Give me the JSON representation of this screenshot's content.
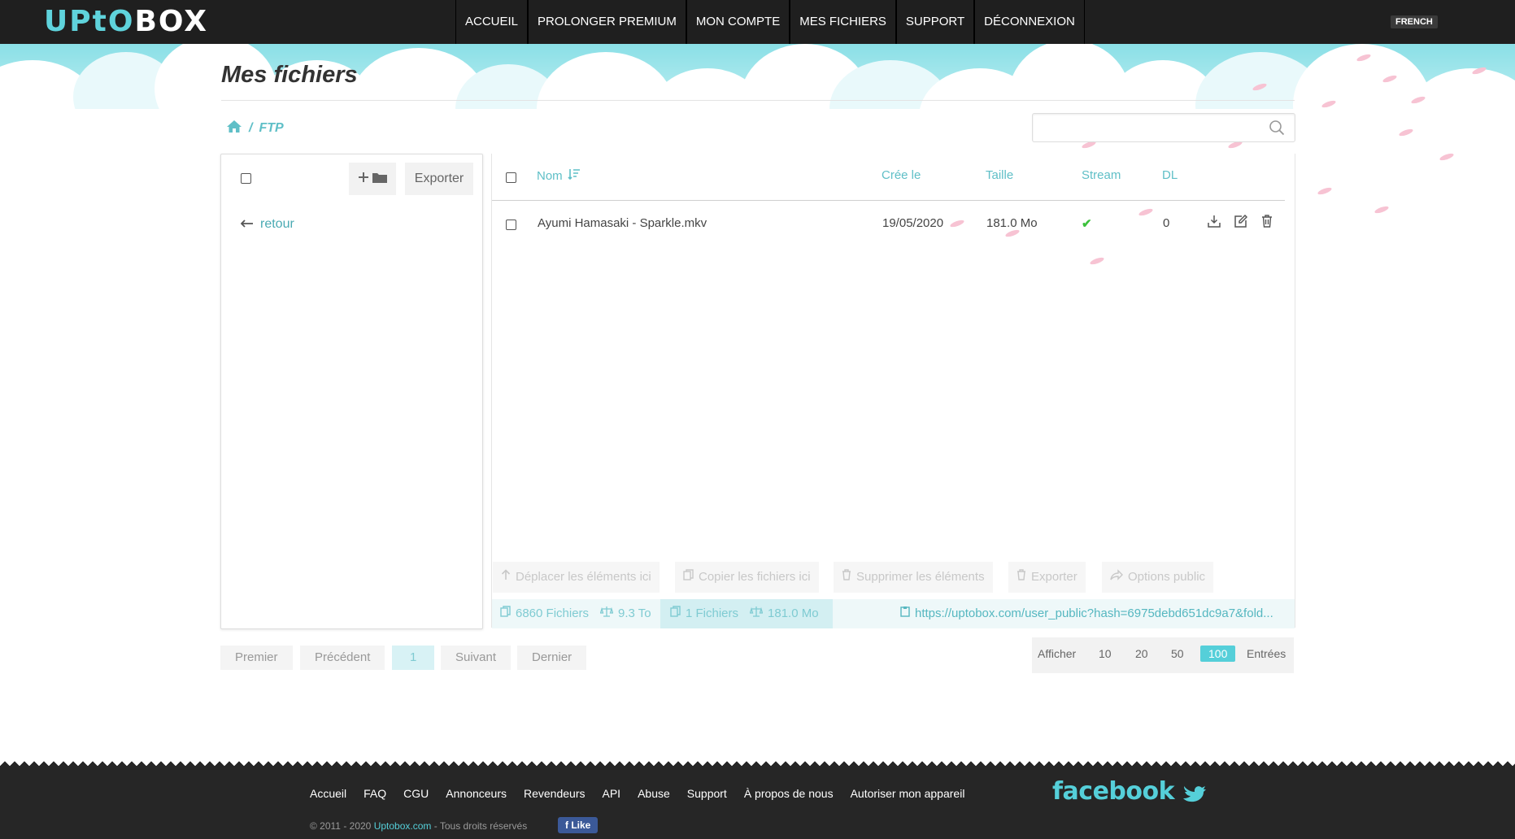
{
  "logo": {
    "part1": "UPtO",
    "part2": "BOX"
  },
  "nav": [
    "ACCUEIL",
    "PROLONGER PREMIUM",
    "MON COMPTE",
    "MES FICHIERS",
    "SUPPORT",
    "DÉCONNEXION"
  ],
  "language": "FRENCH",
  "page_title": "Mes fichiers",
  "breadcrumb": {
    "separator": "/",
    "current": "FTP"
  },
  "search": {
    "placeholder": ""
  },
  "left_panel": {
    "export_label": "Exporter",
    "back_label": "retour"
  },
  "table": {
    "headers": {
      "name": "Nom",
      "created": "Crée le",
      "size": "Taille",
      "stream": "Stream",
      "dl": "DL"
    },
    "rows": [
      {
        "name": "Ayumi Hamasaki - Sparkle.mkv",
        "created": "19/05/2020",
        "size": "181.0 Mo",
        "stream": "✔",
        "dl": "0"
      }
    ]
  },
  "bulk_actions": {
    "move": "Déplacer les éléments ici",
    "copy": "Copier les fichiers ici",
    "delete": "Supprimer les éléments",
    "export": "Exporter",
    "public": "Options public"
  },
  "stats": {
    "total_files": "6860 Fichiers",
    "total_size": "9.3 To",
    "folder_files": "1 Fichiers",
    "folder_size": "181.0 Mo",
    "public_link": "https://uptobox.com/user_public?hash=6975debd651dc9a7&fold..."
  },
  "pagination": {
    "first": "Premier",
    "prev": "Précédent",
    "current": "1",
    "next": "Suivant",
    "last": "Dernier"
  },
  "entries": {
    "label_show": "Afficher",
    "options": [
      "10",
      "20",
      "50",
      "100"
    ],
    "selected": "100",
    "label_entries": "Entrées"
  },
  "footer": {
    "links": [
      "Accueil",
      "FAQ",
      "CGU",
      "Annonceurs",
      "Revendeurs",
      "API",
      "Abuse",
      "Support",
      "À propos de nous",
      "Autoriser mon appareil"
    ],
    "copyright_prefix": "© 2011 - 2020",
    "copyright_brand": "Uptobox.com",
    "copyright_suffix": "- Tous droits réservés",
    "social": "facebook",
    "like_label": "Like"
  },
  "colors": {
    "accent": "#55cfd9",
    "topbar": "#1f1f1f",
    "footer": "#262626",
    "success": "#3cc13c"
  }
}
